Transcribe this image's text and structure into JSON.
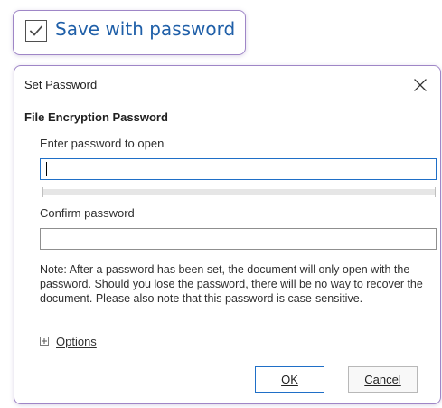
{
  "callout": {
    "checked": true,
    "label": "Save with password",
    "accent_color": "#1f5fa8",
    "border_color": "#9f86c7",
    "icon": "checkbox-checked-icon"
  },
  "dialog": {
    "title": "Set Password",
    "close_icon": "close-icon",
    "section_title": "File Encryption Password",
    "open_password": {
      "label": "Enter password to open",
      "value": "",
      "placeholder": ""
    },
    "strength": {
      "value": 0
    },
    "confirm_password": {
      "label": "Confirm password",
      "value": "",
      "placeholder": ""
    },
    "note": "Note: After a password has been set, the document will only open with the password. Should you lose the password, there will be no way to recover the document. Please also note that this password is case-sensitive.",
    "options": {
      "icon": "expand-plus-icon",
      "label": "Options"
    },
    "buttons": {
      "ok": "OK",
      "cancel": "Cancel"
    },
    "colors": {
      "focus": "#1f6fc7",
      "border": "#9f86c7"
    }
  }
}
